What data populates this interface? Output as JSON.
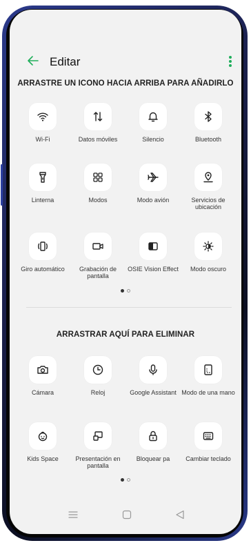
{
  "header": {
    "back_icon": "arrow-left-icon",
    "title": "Editar",
    "more_icon": "more-vertical-icon"
  },
  "add_section": {
    "title": "ARRASTRE UN ICONO HACIA ARRIBA PARA AÑADIRLO",
    "tiles": [
      {
        "label": "Wi-Fi",
        "icon": "wifi-icon"
      },
      {
        "label": "Datos móviles",
        "icon": "mobile-data-icon"
      },
      {
        "label": "Silencio",
        "icon": "bell-icon"
      },
      {
        "label": "Bluetooth",
        "icon": "bluetooth-icon"
      },
      {
        "label": "Linterna",
        "icon": "flashlight-icon"
      },
      {
        "label": "Modos",
        "icon": "modes-grid-icon"
      },
      {
        "label": "Modo avión",
        "icon": "airplane-icon"
      },
      {
        "label": "Servicios de ubicación",
        "icon": "location-icon"
      },
      {
        "label": "Giro automático",
        "icon": "auto-rotate-icon"
      },
      {
        "label": "Grabación de pantalla",
        "icon": "screen-record-icon"
      },
      {
        "label": "OSIE Vision Effect",
        "icon": "vision-effect-icon"
      },
      {
        "label": "Modo oscuro",
        "icon": "dark-mode-icon"
      }
    ],
    "page_current": 1,
    "page_total": 2
  },
  "remove_section": {
    "title": "ARRASTRAR AQUÍ PARA ELIMINAR",
    "tiles": [
      {
        "label": "Cámara",
        "icon": "camera-icon"
      },
      {
        "label": "Reloj",
        "icon": "clock-icon"
      },
      {
        "label": "Google Assistant",
        "icon": "microphone-icon"
      },
      {
        "label": "Modo de una mano",
        "icon": "one-hand-icon"
      },
      {
        "label": "Kids Space",
        "icon": "kids-face-icon"
      },
      {
        "label": "Presentación en pantalla",
        "icon": "screen-cast-icon"
      },
      {
        "label": "Bloquear pa",
        "icon": "lock-icon"
      },
      {
        "label": "Cambiar teclado",
        "icon": "keyboard-icon"
      }
    ],
    "page_current": 1,
    "page_total": 2
  },
  "navbar": {
    "menu_icon": "menu-icon",
    "home_icon": "home-icon",
    "back_icon": "back-triangle-icon"
  },
  "colors": {
    "accent": "#1fae5b",
    "screen_bg": "#f2f2f2",
    "tile_bg": "#ffffff"
  }
}
